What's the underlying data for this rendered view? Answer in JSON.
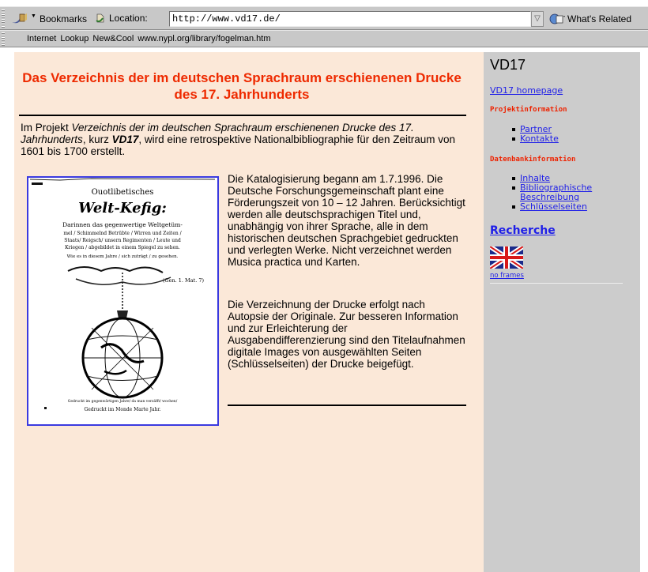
{
  "browser": {
    "bookmarks_label": "Bookmarks",
    "location_label": "Location:",
    "url": "http://www.vd17.de/",
    "whats_related_label": "What's Related",
    "personal_links": [
      "Internet",
      "Lookup",
      "New&Cool",
      "www.nypl.org/library/fogelman.htm"
    ]
  },
  "main": {
    "title": "Das Verzeichnis der im deutschen Sprachraum erschienenen Drucke des 17. Jahrhunderts",
    "intro": {
      "prefix": "Im Projekt ",
      "project_name": "Verzeichnis der im deutschen Sprachraum erschienenen Drucke des 17. Jahrhunderts",
      "middle": ", kurz ",
      "abbrev": "VD17",
      "suffix": ", wird eine retrospektive Nationalbibliographie für den Zeitraum von 1601 bis 1700 erstellt."
    },
    "scan_lines": {
      "line1": "Ouotlibetisches",
      "line2": "Welt-Kefig:",
      "line3": "Darinnen das gegenwertige Weltgetüm-",
      "line4": "mel / Schimmelnd Betrübte / Wirren und Zeiten /",
      "line5": "Staats/ Reigsch/ unsern Regimenten / Leute und",
      "line6": "Kriegen / abgebildet in einem Spiegel zu sehen.",
      "line7": "Wie es in diesem Jahre / sich zuträgt / zu gesehen.",
      "motto": "(Gen. 1. Mat. 7)",
      "footer1": "Gedruckt im gegenwärtigen Jahre/ da man verzäfft/ wochen/",
      "footer2": "Gedruckt im Monde Marte Jahr."
    },
    "paragraph1": "Die Katalogisierung begann am 1.7.1996. Die Deutsche Forschungsgemeinschaft plant eine Förderungszeit von 10 – 12 Jahren. Berücksichtigt werden alle deutschsprachigen Titel und, unabhängig von ihrer Sprache, alle in dem historischen deutschen Sprachgebiet gedruckten und verlegten Werke. Nicht verzeichnet werden Musica practica und Karten.",
    "paragraph2": "Die Verzeichnung der Drucke erfolgt nach Autopsie der Originale. Zur besseren Information und zur Erleichterung der Ausgabendifferenzierung sind den Titelaufnahmen digitale Images von ausgewählten Seiten (Schlüsselseiten) der Drucke beigefügt."
  },
  "sidebar": {
    "title": "VD17",
    "home_link": "VD17 homepage",
    "section1_heading": "Projektinformation",
    "section1_items": [
      "Partner",
      "Kontakte"
    ],
    "section2_heading": "Datenbankinformation",
    "section2_items": [
      "Inhalte",
      "Bibliographische Beschreibung",
      "Schlüsselseiten"
    ],
    "search_link": "Recherche",
    "flag_icon": "uk-flag-icon",
    "noframes_link": "no frames"
  },
  "colors": {
    "title_red": "#ee2a00",
    "link_blue": "#1f1fe8",
    "main_bg": "#fbe8d8",
    "sidebar_bg": "#cccccc"
  }
}
